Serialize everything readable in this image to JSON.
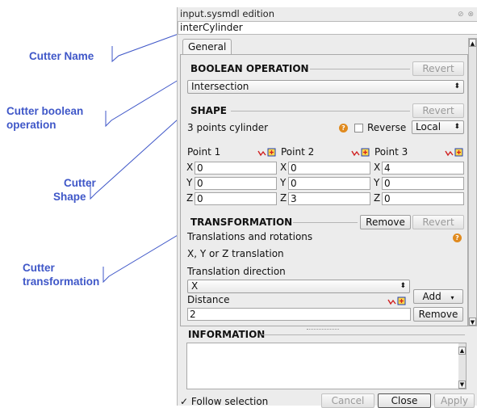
{
  "annotations": {
    "cutter_name": "Cutter Name",
    "cutter_boolean": [
      "Cutter boolean",
      "operation"
    ],
    "cutter_shape": [
      "Cutter",
      "Shape"
    ],
    "cutter_transformation": [
      "Cutter",
      "transformation"
    ]
  },
  "window": {
    "title": "input.sysmdl edition",
    "name_value": "interCylinder"
  },
  "tabs": {
    "general": "General"
  },
  "boolean_section": {
    "title": "BOOLEAN OPERATION",
    "revert_label": "Revert",
    "operation_value": "Intersection"
  },
  "shape_section": {
    "title": "SHAPE",
    "revert_label": "Revert",
    "shape_type": "3 points cylinder",
    "reverse_label": "Reverse",
    "frame_value": "Local",
    "points": [
      {
        "label": "Point 1",
        "x": "0",
        "y": "0",
        "z": "0"
      },
      {
        "label": "Point 2",
        "x": "0",
        "y": "0",
        "z": "3"
      },
      {
        "label": "Point 3",
        "x": "4",
        "y": "0",
        "z": "0"
      }
    ],
    "axis_labels": {
      "x": "X",
      "y": "Y",
      "z": "Z"
    }
  },
  "transformation_section": {
    "title": "TRANSFORMATION",
    "remove_label": "Remove",
    "revert_label": "Revert",
    "subtitle": "Translations and rotations",
    "translation_type": "X, Y or Z translation",
    "direction_label": "Translation direction",
    "direction_value": "X",
    "distance_label": "Distance",
    "distance_value": "2",
    "add_label": "Add",
    "remove2_label": "Remove"
  },
  "information_section": {
    "title": "INFORMATION"
  },
  "footer": {
    "follow_selection": "Follow selection",
    "cancel_label": "Cancel",
    "close_label": "Close",
    "apply_label": "Apply"
  },
  "colors": {
    "annotation": "#3f57c8",
    "help_icon": "#e08a1e"
  }
}
